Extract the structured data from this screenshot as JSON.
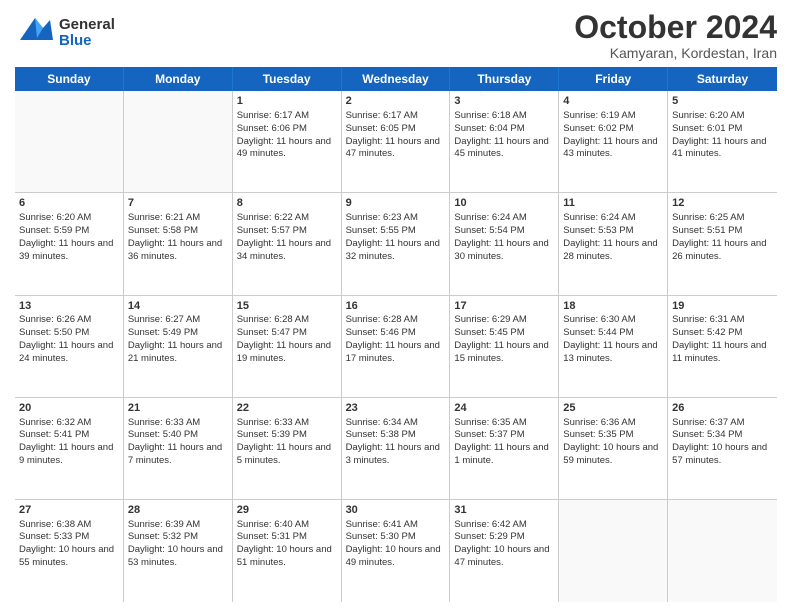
{
  "header": {
    "month_title": "October 2024",
    "location": "Kamyaran, Kordestan, Iran",
    "logo_general": "General",
    "logo_blue": "Blue"
  },
  "days_of_week": [
    "Sunday",
    "Monday",
    "Tuesday",
    "Wednesday",
    "Thursday",
    "Friday",
    "Saturday"
  ],
  "weeks": [
    [
      {
        "day": "",
        "sunrise": "",
        "sunset": "",
        "daylight": ""
      },
      {
        "day": "",
        "sunrise": "",
        "sunset": "",
        "daylight": ""
      },
      {
        "day": "1",
        "sunrise": "Sunrise: 6:17 AM",
        "sunset": "Sunset: 6:06 PM",
        "daylight": "Daylight: 11 hours and 49 minutes."
      },
      {
        "day": "2",
        "sunrise": "Sunrise: 6:17 AM",
        "sunset": "Sunset: 6:05 PM",
        "daylight": "Daylight: 11 hours and 47 minutes."
      },
      {
        "day": "3",
        "sunrise": "Sunrise: 6:18 AM",
        "sunset": "Sunset: 6:04 PM",
        "daylight": "Daylight: 11 hours and 45 minutes."
      },
      {
        "day": "4",
        "sunrise": "Sunrise: 6:19 AM",
        "sunset": "Sunset: 6:02 PM",
        "daylight": "Daylight: 11 hours and 43 minutes."
      },
      {
        "day": "5",
        "sunrise": "Sunrise: 6:20 AM",
        "sunset": "Sunset: 6:01 PM",
        "daylight": "Daylight: 11 hours and 41 minutes."
      }
    ],
    [
      {
        "day": "6",
        "sunrise": "Sunrise: 6:20 AM",
        "sunset": "Sunset: 5:59 PM",
        "daylight": "Daylight: 11 hours and 39 minutes."
      },
      {
        "day": "7",
        "sunrise": "Sunrise: 6:21 AM",
        "sunset": "Sunset: 5:58 PM",
        "daylight": "Daylight: 11 hours and 36 minutes."
      },
      {
        "day": "8",
        "sunrise": "Sunrise: 6:22 AM",
        "sunset": "Sunset: 5:57 PM",
        "daylight": "Daylight: 11 hours and 34 minutes."
      },
      {
        "day": "9",
        "sunrise": "Sunrise: 6:23 AM",
        "sunset": "Sunset: 5:55 PM",
        "daylight": "Daylight: 11 hours and 32 minutes."
      },
      {
        "day": "10",
        "sunrise": "Sunrise: 6:24 AM",
        "sunset": "Sunset: 5:54 PM",
        "daylight": "Daylight: 11 hours and 30 minutes."
      },
      {
        "day": "11",
        "sunrise": "Sunrise: 6:24 AM",
        "sunset": "Sunset: 5:53 PM",
        "daylight": "Daylight: 11 hours and 28 minutes."
      },
      {
        "day": "12",
        "sunrise": "Sunrise: 6:25 AM",
        "sunset": "Sunset: 5:51 PM",
        "daylight": "Daylight: 11 hours and 26 minutes."
      }
    ],
    [
      {
        "day": "13",
        "sunrise": "Sunrise: 6:26 AM",
        "sunset": "Sunset: 5:50 PM",
        "daylight": "Daylight: 11 hours and 24 minutes."
      },
      {
        "day": "14",
        "sunrise": "Sunrise: 6:27 AM",
        "sunset": "Sunset: 5:49 PM",
        "daylight": "Daylight: 11 hours and 21 minutes."
      },
      {
        "day": "15",
        "sunrise": "Sunrise: 6:28 AM",
        "sunset": "Sunset: 5:47 PM",
        "daylight": "Daylight: 11 hours and 19 minutes."
      },
      {
        "day": "16",
        "sunrise": "Sunrise: 6:28 AM",
        "sunset": "Sunset: 5:46 PM",
        "daylight": "Daylight: 11 hours and 17 minutes."
      },
      {
        "day": "17",
        "sunrise": "Sunrise: 6:29 AM",
        "sunset": "Sunset: 5:45 PM",
        "daylight": "Daylight: 11 hours and 15 minutes."
      },
      {
        "day": "18",
        "sunrise": "Sunrise: 6:30 AM",
        "sunset": "Sunset: 5:44 PM",
        "daylight": "Daylight: 11 hours and 13 minutes."
      },
      {
        "day": "19",
        "sunrise": "Sunrise: 6:31 AM",
        "sunset": "Sunset: 5:42 PM",
        "daylight": "Daylight: 11 hours and 11 minutes."
      }
    ],
    [
      {
        "day": "20",
        "sunrise": "Sunrise: 6:32 AM",
        "sunset": "Sunset: 5:41 PM",
        "daylight": "Daylight: 11 hours and 9 minutes."
      },
      {
        "day": "21",
        "sunrise": "Sunrise: 6:33 AM",
        "sunset": "Sunset: 5:40 PM",
        "daylight": "Daylight: 11 hours and 7 minutes."
      },
      {
        "day": "22",
        "sunrise": "Sunrise: 6:33 AM",
        "sunset": "Sunset: 5:39 PM",
        "daylight": "Daylight: 11 hours and 5 minutes."
      },
      {
        "day": "23",
        "sunrise": "Sunrise: 6:34 AM",
        "sunset": "Sunset: 5:38 PM",
        "daylight": "Daylight: 11 hours and 3 minutes."
      },
      {
        "day": "24",
        "sunrise": "Sunrise: 6:35 AM",
        "sunset": "Sunset: 5:37 PM",
        "daylight": "Daylight: 11 hours and 1 minute."
      },
      {
        "day": "25",
        "sunrise": "Sunrise: 6:36 AM",
        "sunset": "Sunset: 5:35 PM",
        "daylight": "Daylight: 10 hours and 59 minutes."
      },
      {
        "day": "26",
        "sunrise": "Sunrise: 6:37 AM",
        "sunset": "Sunset: 5:34 PM",
        "daylight": "Daylight: 10 hours and 57 minutes."
      }
    ],
    [
      {
        "day": "27",
        "sunrise": "Sunrise: 6:38 AM",
        "sunset": "Sunset: 5:33 PM",
        "daylight": "Daylight: 10 hours and 55 minutes."
      },
      {
        "day": "28",
        "sunrise": "Sunrise: 6:39 AM",
        "sunset": "Sunset: 5:32 PM",
        "daylight": "Daylight: 10 hours and 53 minutes."
      },
      {
        "day": "29",
        "sunrise": "Sunrise: 6:40 AM",
        "sunset": "Sunset: 5:31 PM",
        "daylight": "Daylight: 10 hours and 51 minutes."
      },
      {
        "day": "30",
        "sunrise": "Sunrise: 6:41 AM",
        "sunset": "Sunset: 5:30 PM",
        "daylight": "Daylight: 10 hours and 49 minutes."
      },
      {
        "day": "31",
        "sunrise": "Sunrise: 6:42 AM",
        "sunset": "Sunset: 5:29 PM",
        "daylight": "Daylight: 10 hours and 47 minutes."
      },
      {
        "day": "",
        "sunrise": "",
        "sunset": "",
        "daylight": ""
      },
      {
        "day": "",
        "sunrise": "",
        "sunset": "",
        "daylight": ""
      }
    ]
  ]
}
